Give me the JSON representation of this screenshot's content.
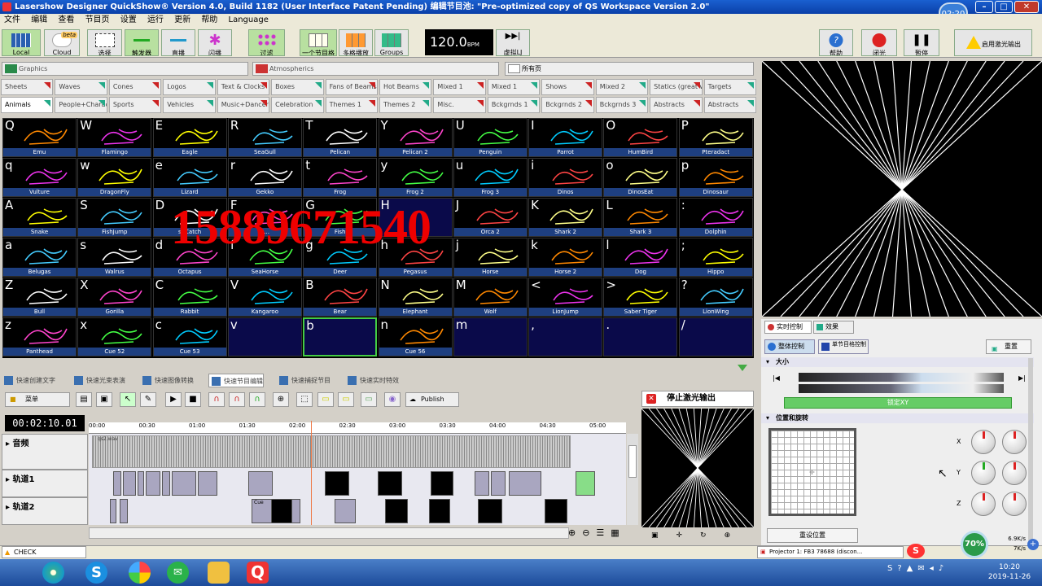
{
  "window": {
    "title": "Lasershow Designer QuickShow® Version 4.0, Build 1182 (User Interface Patent Pending) 编辑节目池: \"Pre-optimized copy of QS Workspace Version 2.0\"",
    "clock": "02:20"
  },
  "menu": [
    "文件",
    "编辑",
    "查看",
    "节目页",
    "设置",
    "运行",
    "更新",
    "帮助",
    "Language"
  ],
  "toolbar": {
    "local": "Local",
    "cloud": "Cloud",
    "beta": "beta",
    "select": "选择",
    "trigger": "触发器",
    "live": "直播",
    "flash": "闪播",
    "filter": "过滤",
    "one_cue": "一个节目格",
    "multi": "多格播放",
    "groups": "Groups",
    "help": "帮助",
    "close": "闭光",
    "pause": "暂停",
    "enable": "启用激光输出",
    "bpm_value": "120.0",
    "bpm_unit": "BPM",
    "virtual_lj": "虚拟LJ"
  },
  "categories": {
    "graphics": "Graphics",
    "atmospherics": "Atmospherics",
    "all_pages": "所有页"
  },
  "tabs_row1": [
    "Sheets",
    "Waves",
    "Cones",
    "Logos",
    "Text & Clocks",
    "Boxes",
    "Fans of Beams",
    "Hot Beams",
    "Mixed 1",
    "Mixed 1",
    "Shows",
    "Mixed 2",
    "Statics (great with Virtu",
    "Targets"
  ],
  "tabs_row2": [
    "Animals",
    "People+Characters",
    "Sports",
    "Vehicles",
    "Music+Dancers",
    "Celebration",
    "Themes 1",
    "Themes 2",
    "Misc.",
    "Bckgrnds 1",
    "Bckgrnds 2",
    "Bckgrnds 3",
    "Abstracts",
    "Abstracts"
  ],
  "cue_grid": [
    [
      [
        "Q",
        "Emu"
      ],
      [
        "W",
        "Flamingo"
      ],
      [
        "E",
        "Eagle"
      ],
      [
        "R",
        "SeaGull"
      ],
      [
        "T",
        "Pelican"
      ],
      [
        "Y",
        "Pelican 2"
      ],
      [
        "U",
        "Penguin"
      ],
      [
        "I",
        "Parrot"
      ],
      [
        "O",
        "HumBird"
      ],
      [
        "P",
        "Pteradact"
      ]
    ],
    [
      [
        "q",
        "Vulture"
      ],
      [
        "w",
        "DragonFly"
      ],
      [
        "e",
        "Lizard"
      ],
      [
        "r",
        "Gekko"
      ],
      [
        "t",
        "Frog"
      ],
      [
        "y",
        "Frog 2"
      ],
      [
        "u",
        "Frog 3"
      ],
      [
        "i",
        "Dinos"
      ],
      [
        "o",
        "DinosEat"
      ],
      [
        "p",
        "Dinosaur"
      ]
    ],
    [
      [
        "A",
        "Snake"
      ],
      [
        "S",
        "FishJump"
      ],
      [
        "D",
        "shCatch"
      ],
      [
        "F",
        "S..."
      ],
      [
        "G",
        "Fish"
      ],
      [
        "H",
        ""
      ],
      [
        "J",
        "Orca 2"
      ],
      [
        "K",
        "Shark 2"
      ],
      [
        "L",
        "Shark 3"
      ],
      [
        ":",
        "Dolphin"
      ]
    ],
    [
      [
        "a",
        "Belugas"
      ],
      [
        "s",
        "Walrus"
      ],
      [
        "d",
        "Octapus"
      ],
      [
        "f",
        "SeaHorse"
      ],
      [
        "g",
        "Deer"
      ],
      [
        "h",
        "Pegasus"
      ],
      [
        "j",
        "Horse"
      ],
      [
        "k",
        "Horse 2"
      ],
      [
        "l",
        "Dog"
      ],
      [
        ";",
        "Hippo"
      ]
    ],
    [
      [
        "Z",
        "Bull"
      ],
      [
        "X",
        "Gorilla"
      ],
      [
        "C",
        "Rabbit"
      ],
      [
        "V",
        "Kangaroo"
      ],
      [
        "B",
        "Bear"
      ],
      [
        "N",
        "Elephant"
      ],
      [
        "M",
        "Wolf"
      ],
      [
        "<",
        "LionJump"
      ],
      [
        ">",
        "Saber Tiger"
      ],
      [
        "?",
        "LionWing"
      ]
    ],
    [
      [
        "z",
        "Panthead"
      ],
      [
        "x",
        "Cue 52"
      ],
      [
        "c",
        "Cue 53"
      ],
      [
        "v",
        ""
      ],
      [
        "b",
        ""
      ],
      [
        "n",
        "Cue 56"
      ],
      [
        "m",
        ""
      ],
      [
        ",",
        ""
      ],
      [
        ".",
        ""
      ],
      [
        "/",
        ""
      ]
    ]
  ],
  "cue_hues": [
    "#f80",
    "#e3e",
    "#ff0",
    "#4cf",
    "#fff",
    "#f4c",
    "#4f4",
    "#0cf",
    "#f44",
    "#ff8"
  ],
  "watermark": "15889671540",
  "bottom_tabs": [
    "快速创建文字",
    "快速光束表演",
    "快速图像转换",
    "快速节目编辑",
    "快速捕捉节目",
    "快速实时特效"
  ],
  "timeline": {
    "time": "00:02:10.01",
    "menu": "菜单",
    "publish": "Publish",
    "ticks": [
      "00:00",
      "00:30",
      "01:00",
      "01:30",
      "02:00",
      "02:30",
      "03:00",
      "03:30",
      "04:00",
      "04:30",
      "05:00"
    ],
    "tracks": [
      "音频",
      "轨道1",
      "轨道2"
    ],
    "audio_file": "qs2.wav",
    "cue_label": "Cue",
    "stop": "停止激光输出"
  },
  "controls": {
    "tab_live": "实时控制",
    "tab_effects": "效果",
    "overall": "整体控制",
    "cue_ctl": "单节目格控制",
    "reset": "重置",
    "size": "大小",
    "lock_xy": "锁定XY",
    "pos_rot": "位置和旋转",
    "reset_pos": "重设位置",
    "x": "X",
    "y": "Y",
    "z": "Z"
  },
  "status": {
    "check": "CHECK",
    "projector": "Projector 1: FB3 78688 (discon...",
    "net_pct": "70%",
    "up": "6.9K/s",
    "down": "7K/s",
    "time": "10:20",
    "date": "2019-11-26"
  }
}
